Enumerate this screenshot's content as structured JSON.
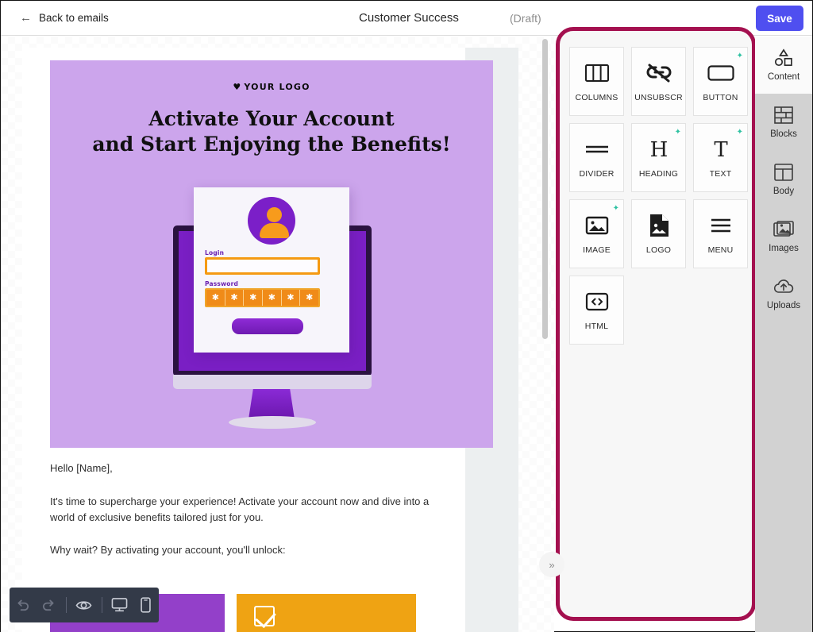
{
  "topbar": {
    "back_label": "Back to emails",
    "back_icon": "arrow-left-icon",
    "doc_title": "Customer Success",
    "doc_state": "(Draft)",
    "save_label": "Save",
    "save_color": "#4f4ff0"
  },
  "email": {
    "hero": {
      "logo_text": "YOUR LOGO",
      "logo_heart": "♥",
      "title_line1": "Activate Your Account",
      "title_line2": "and Start Enjoying the Benefits!",
      "bg_color": "#cca5ec",
      "illustration": {
        "name": "login-screen-illustration",
        "login_label": "Login",
        "password_label": "Password",
        "password_chars": [
          "✱",
          "✱",
          "✱",
          "✱",
          "✱",
          "✱"
        ]
      }
    },
    "paragraphs": [
      "Hello [Name],",
      "It's time to supercharge your experience! Activate your account now and dive into a world of exclusive benefits tailored just for you.",
      "Why wait? By activating your account, you'll unlock:"
    ],
    "cta_blocks": [
      {
        "name": "cta-purple-block",
        "color": "#9340c9",
        "icon": ""
      },
      {
        "name": "cta-orange-block",
        "color": "#efa313",
        "icon": "check-square-icon"
      }
    ]
  },
  "collapse_handle": {
    "icon": "chevron-double-right-icon",
    "glyph": "»"
  },
  "panel": {
    "border_color": "#a4104f",
    "blocks": [
      {
        "label": "COLUMNS",
        "icon": "columns-icon",
        "sparkle": false
      },
      {
        "label": "UNSUBSCR",
        "icon": "unsubscribe-icon",
        "sparkle": false
      },
      {
        "label": "BUTTON",
        "icon": "button-icon",
        "sparkle": true
      },
      {
        "label": "DIVIDER",
        "icon": "divider-icon",
        "sparkle": false
      },
      {
        "label": "HEADING",
        "icon": "heading-icon",
        "sparkle": true
      },
      {
        "label": "TEXT",
        "icon": "text-icon",
        "sparkle": true
      },
      {
        "label": "IMAGE",
        "icon": "image-icon",
        "sparkle": true
      },
      {
        "label": "LOGO",
        "icon": "logo-icon",
        "sparkle": false
      },
      {
        "label": "MENU",
        "icon": "menu-icon",
        "sparkle": false
      },
      {
        "label": "HTML",
        "icon": "html-code-icon",
        "sparkle": false
      }
    ]
  },
  "sidebar": {
    "items": [
      {
        "label": "Content",
        "icon": "shapes-icon",
        "active": true
      },
      {
        "label": "Blocks",
        "icon": "bricks-icon",
        "active": false
      },
      {
        "label": "Body",
        "icon": "layout-icon",
        "active": false
      },
      {
        "label": "Images",
        "icon": "images-icon",
        "active": false
      },
      {
        "label": "Uploads",
        "icon": "upload-cloud-icon",
        "active": false
      }
    ]
  },
  "bottom_toolbar": {
    "buttons": [
      {
        "name": "undo-button",
        "icon": "undo-icon",
        "enabled": false
      },
      {
        "name": "redo-button",
        "icon": "redo-icon",
        "enabled": false
      },
      {
        "name": "preview-button",
        "icon": "eye-icon",
        "enabled": true
      },
      {
        "name": "desktop-view-button",
        "icon": "desktop-icon",
        "enabled": true
      },
      {
        "name": "mobile-view-button",
        "icon": "mobile-icon",
        "enabled": true
      }
    ]
  }
}
